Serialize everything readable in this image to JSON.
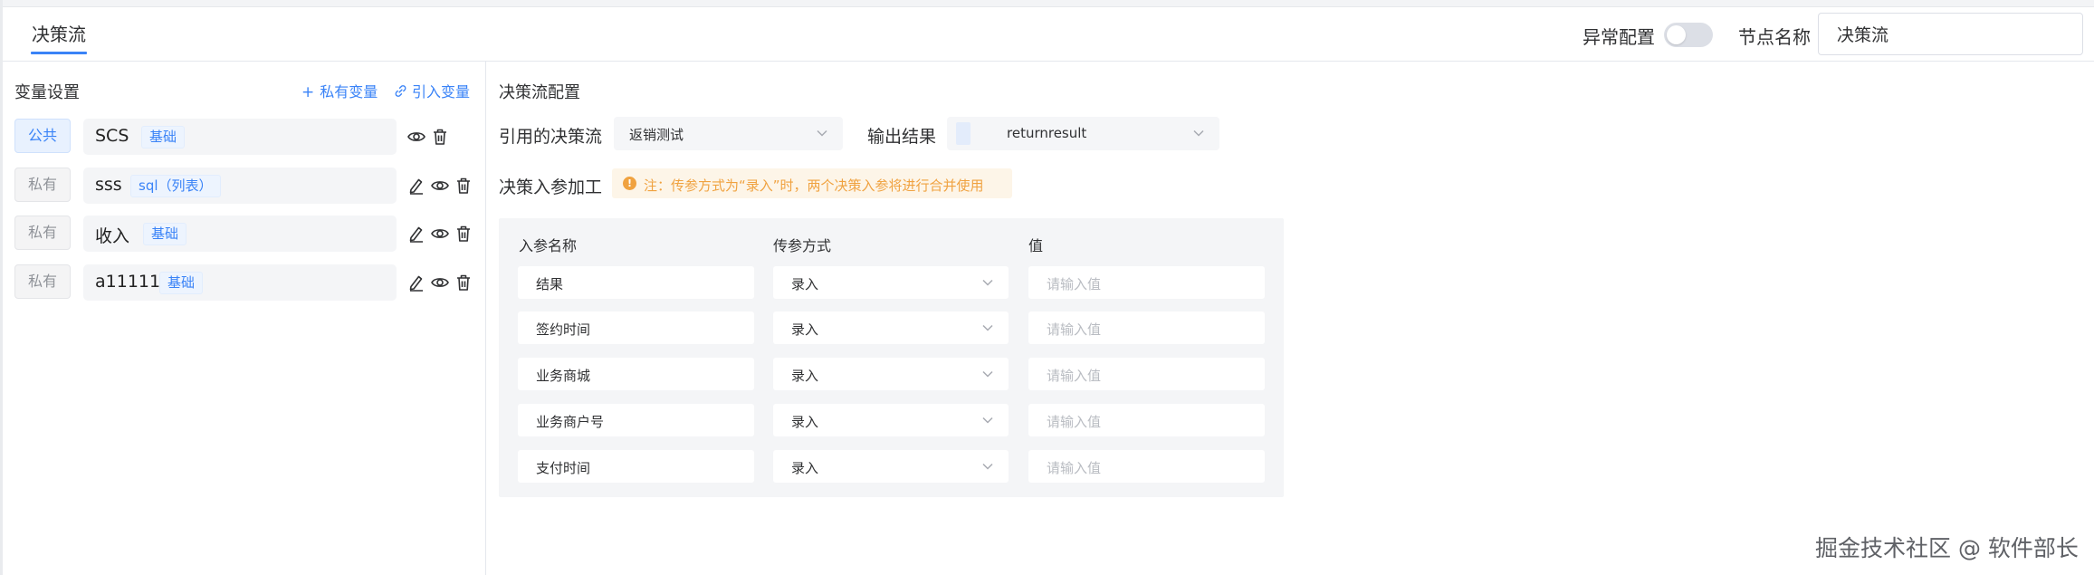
{
  "header": {
    "tab_title": "决策流",
    "exception_label": "异常配置",
    "exception_enabled": false,
    "node_name_label": "节点名称",
    "node_name_value": "决策流"
  },
  "variables": {
    "title": "变量设置",
    "add_private_label": "私有变量",
    "import_label": "引入变量",
    "items": [
      {
        "scope": "公共",
        "name": "SCS",
        "tag": "基础",
        "actions": [
          "view",
          "delete"
        ]
      },
      {
        "scope": "私有",
        "name": "sss",
        "tag": "sql（列表）",
        "actions": [
          "edit",
          "view",
          "delete"
        ]
      },
      {
        "scope": "私有",
        "name": "收入",
        "tag": "基础",
        "actions": [
          "edit",
          "view",
          "delete"
        ]
      },
      {
        "scope": "私有",
        "name": "a11111",
        "tag": "基础",
        "actions": [
          "edit",
          "view",
          "delete"
        ]
      }
    ]
  },
  "config": {
    "title": "决策流配置",
    "ref_label": "引用的决策流",
    "ref_value": "返销测试",
    "output_label": "输出结果",
    "output_value": "returnresult",
    "param_label": "决策入参加工",
    "notice": "注：传参方式为“录入”时，两个决策入参将进行合并使用",
    "table": {
      "headers": [
        "入参名称",
        "传参方式",
        "值"
      ],
      "rows": [
        {
          "name": "结果",
          "method": "录入",
          "value_placeholder": "请输入值"
        },
        {
          "name": "签约时间",
          "method": "录入",
          "value_placeholder": "请输入值"
        },
        {
          "name": "业务商城",
          "method": "录入",
          "value_placeholder": "请输入值"
        },
        {
          "name": "业务商户号",
          "method": "录入",
          "value_placeholder": "请输入值"
        },
        {
          "name": "支付时间",
          "method": "录入",
          "value_placeholder": "请输入值"
        }
      ]
    }
  },
  "watermark": "掘金技术社区 @ 软件部长",
  "colors": {
    "accent": "#3a83f7",
    "warning": "#f0a240",
    "panel_bg": "#f4f5f7"
  }
}
